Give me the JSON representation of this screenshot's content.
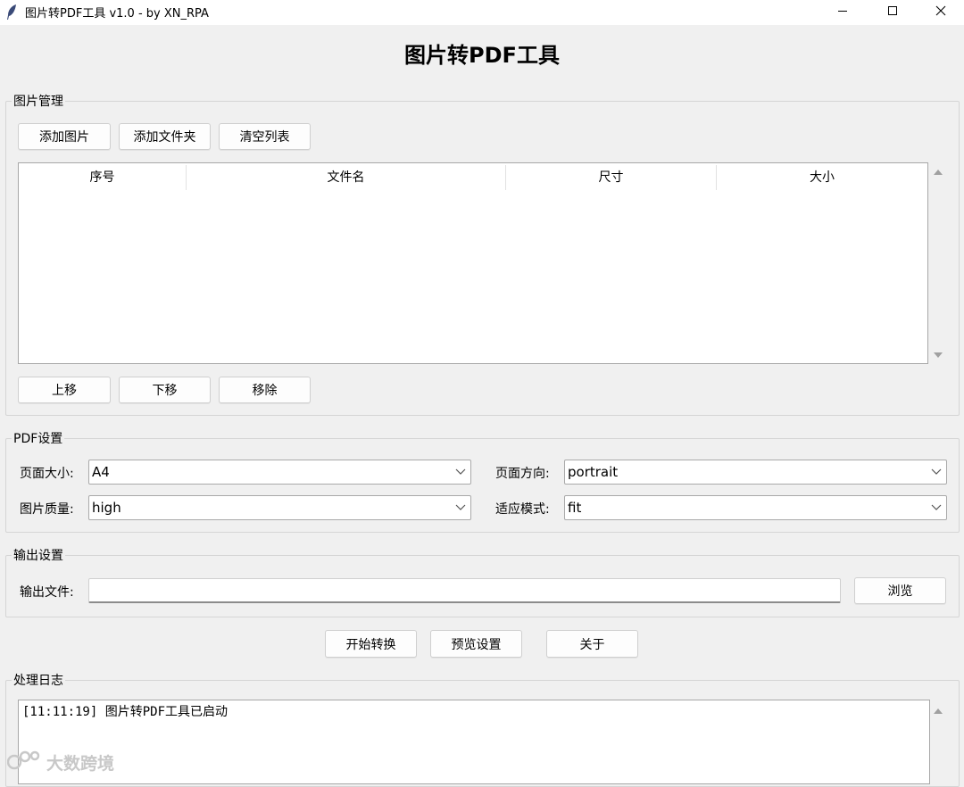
{
  "window": {
    "title": "图片转PDF工具 v1.0 - by XN_RPA",
    "controls": [
      "minimize-icon",
      "maximize-icon",
      "close-icon"
    ]
  },
  "header": {
    "title": "图片转PDF工具"
  },
  "image_group": {
    "label": "图片管理",
    "buttons": {
      "add_image": "添加图片",
      "add_folder": "添加文件夹",
      "clear_list": "清空列表"
    },
    "table": {
      "columns": [
        "序号",
        "文件名",
        "尺寸",
        "大小"
      ],
      "rows": []
    },
    "move_buttons": {
      "up": "上移",
      "down": "下移",
      "remove": "移除"
    }
  },
  "pdf_group": {
    "label": "PDF设置",
    "page_size": {
      "label": "页面大小:",
      "value": "A4"
    },
    "orientation": {
      "label": "页面方向:",
      "value": "portrait"
    },
    "quality": {
      "label": "图片质量:",
      "value": "high"
    },
    "fit_mode": {
      "label": "适应模式:",
      "value": "fit"
    }
  },
  "output_group": {
    "label": "输出设置",
    "output_file": {
      "label": "输出文件:",
      "value": ""
    },
    "browse_button": "浏览"
  },
  "actions": {
    "start": "开始转换",
    "preview": "预览设置",
    "about": "关于"
  },
  "log_group": {
    "label": "处理日志",
    "lines": [
      "[11:11:19] 图片转PDF工具已启动"
    ]
  },
  "watermark": {
    "text": "大数跨境"
  }
}
